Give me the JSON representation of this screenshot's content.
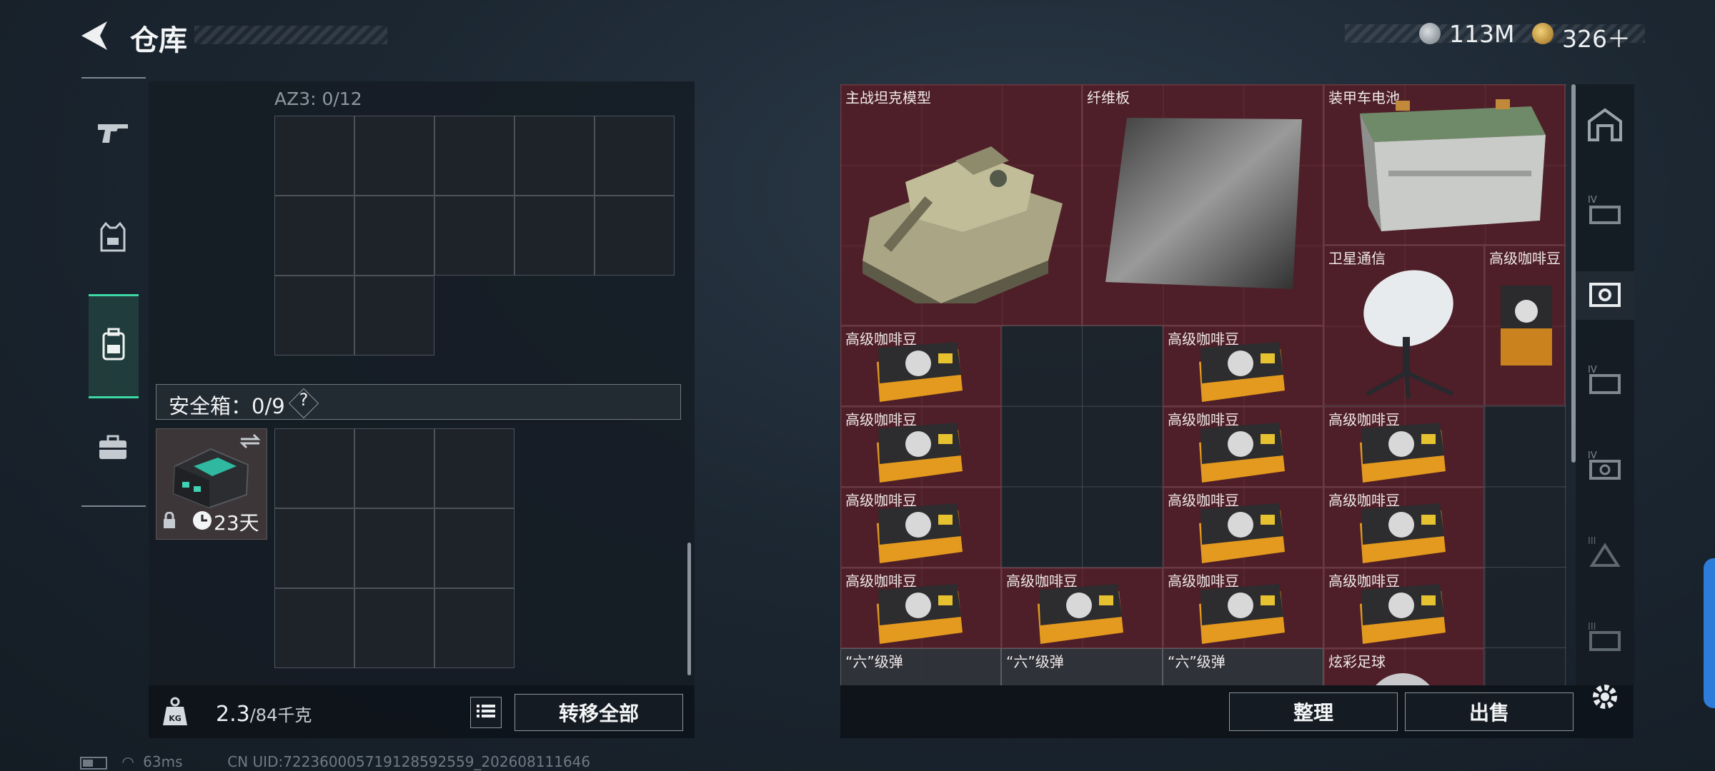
{
  "header": {
    "title": "仓库"
  },
  "currency": {
    "money": "113M",
    "tokens": "326＋"
  },
  "left_panel": {
    "backpack_label": "AZ3: 0/12",
    "safe_label": "安全箱：0/9",
    "safe_help": "?",
    "safebox_timer": "23天",
    "weight_current": "2.3",
    "weight_max": "/84千克",
    "transfer_all": "转移全部"
  },
  "stash_items": [
    {
      "label": "主战坦克模型"
    },
    {
      "label": "纤维板"
    },
    {
      "label": "装甲车电池"
    },
    {
      "label": "卫星通信"
    },
    {
      "label": "高级咖啡豆"
    },
    {
      "label": "高级咖啡豆"
    },
    {
      "label": "高级咖啡豆"
    },
    {
      "label": "高级咖啡豆"
    },
    {
      "label": "高级咖啡豆"
    },
    {
      "label": "高级咖啡豆"
    },
    {
      "label": "高级咖啡豆"
    },
    {
      "label": "高级咖啡豆"
    },
    {
      "label": "高级咖啡豆"
    },
    {
      "label": "高级咖啡豆"
    },
    {
      "label": "高级咖啡豆"
    },
    {
      "label": "高级咖啡豆"
    },
    {
      "label": "高级咖啡豆"
    },
    {
      "label": "“六”级弹"
    },
    {
      "label": "“六”级弹"
    },
    {
      "label": "“六”级弹"
    },
    {
      "label": "炫彩足球"
    }
  ],
  "actions": {
    "sort": "整理",
    "sell": "出售"
  },
  "status_bar": {
    "ping": "63ms",
    "uid": "CN UID:7223600057191285925​59_202608111646"
  },
  "colors": {
    "accent": "#3dd9a4",
    "item_bg": "#541f28",
    "edge": "#2d7cd9"
  }
}
